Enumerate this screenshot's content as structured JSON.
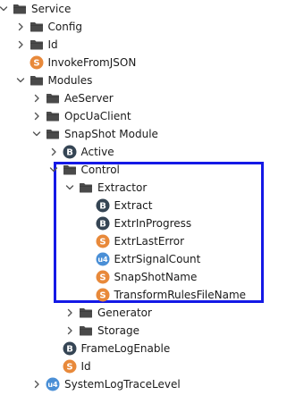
{
  "tree": {
    "nodes": [
      {
        "label": "Service",
        "type": "folder",
        "expander": "expanded",
        "icon": "folder-icon",
        "color": "#4a4a4a"
      },
      {
        "label": "Config",
        "type": "folder",
        "expander": "collapsed",
        "icon": "folder-icon",
        "color": "#4a4a4a"
      },
      {
        "label": "Id",
        "type": "folder",
        "expander": "collapsed",
        "icon": "folder-icon",
        "color": "#4a4a4a"
      },
      {
        "label": "InvokeFromJSON",
        "type": "variable",
        "badge": "S",
        "icon": "string-variable-icon",
        "color": "#e8893a"
      },
      {
        "label": "Modules",
        "type": "folder",
        "expander": "expanded",
        "icon": "folder-icon",
        "color": "#4a4a4a"
      },
      {
        "label": "AeServer",
        "type": "folder",
        "expander": "collapsed",
        "icon": "folder-icon",
        "color": "#4a4a4a"
      },
      {
        "label": "OpcUaClient",
        "type": "folder",
        "expander": "collapsed",
        "icon": "folder-icon",
        "color": "#4a4a4a"
      },
      {
        "label": "SnapShot Module",
        "type": "folder",
        "expander": "expanded",
        "icon": "folder-icon",
        "color": "#4a4a4a"
      },
      {
        "label": "Active",
        "type": "variable",
        "expander": "collapsed",
        "badge": "B",
        "icon": "boolean-variable-icon",
        "color": "#354554"
      },
      {
        "label": "Control",
        "type": "folder",
        "expander": "expanded",
        "icon": "folder-icon",
        "color": "#4a4a4a"
      },
      {
        "label": "Extractor",
        "type": "folder",
        "expander": "expanded",
        "icon": "folder-icon",
        "color": "#4a4a4a"
      },
      {
        "label": "Extract",
        "type": "variable",
        "badge": "B",
        "icon": "boolean-variable-icon",
        "color": "#354554"
      },
      {
        "label": "ExtrInProgress",
        "type": "variable",
        "badge": "B",
        "icon": "boolean-variable-icon",
        "color": "#354554"
      },
      {
        "label": "ExtrLastError",
        "type": "variable",
        "badge": "S",
        "icon": "string-variable-icon",
        "color": "#e8893a"
      },
      {
        "label": "ExtrSignalCount",
        "type": "variable",
        "badge": "u4",
        "icon": "uint32-variable-icon",
        "color": "#4a8fd6"
      },
      {
        "label": "SnapShotName",
        "type": "variable",
        "badge": "S",
        "icon": "string-variable-icon",
        "color": "#e8893a"
      },
      {
        "label": "TransformRulesFileName",
        "type": "variable",
        "badge": "S",
        "icon": "string-variable-icon",
        "color": "#e8893a"
      },
      {
        "label": "Generator",
        "type": "folder",
        "expander": "collapsed",
        "icon": "folder-icon",
        "color": "#4a4a4a"
      },
      {
        "label": "Storage",
        "type": "folder",
        "expander": "collapsed",
        "icon": "folder-icon",
        "color": "#4a4a4a"
      },
      {
        "label": "FrameLogEnable",
        "type": "variable",
        "badge": "B",
        "icon": "boolean-variable-icon",
        "color": "#354554"
      },
      {
        "label": "Id",
        "type": "variable",
        "badge": "S",
        "icon": "string-variable-icon",
        "color": "#e8893a"
      },
      {
        "label": "SystemLogTraceLevel",
        "type": "variable",
        "expander": "collapsed",
        "badge": "u4",
        "icon": "uint32-variable-icon",
        "color": "#4a8fd6"
      }
    ]
  },
  "highlight": {
    "color": "#1419e6"
  }
}
